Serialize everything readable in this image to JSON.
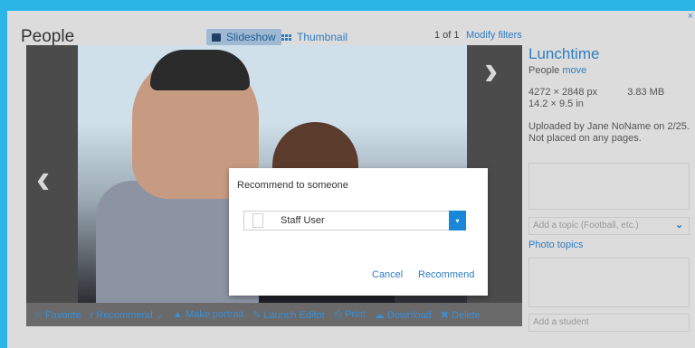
{
  "header": {
    "title": "People",
    "slideshow_label": "Slideshow",
    "thumbnail_label": "Thumbnail",
    "counter": "1 of 1",
    "modify_filters": "Modify filters",
    "close": "×"
  },
  "viewer": {
    "prev": "‹",
    "next": "›"
  },
  "toolbar": {
    "favorite": "☆ Favorite",
    "recommend": "r Recommend ⌄",
    "make_portrait": "▲ Make portrait",
    "launch_editor": "✎ Launch Editor",
    "print": "⎙ Print",
    "download": "☁ Download",
    "delete": "✖ Delete"
  },
  "details": {
    "title": "Lunchtime",
    "section": "People",
    "move": "move",
    "dimensions": "4272 × 2848 px",
    "filesize": "3.83 MB",
    "print_size": "14.2 × 9.5 in",
    "uploaded": "Uploaded by Jane NoName on 2/25.",
    "placement": "Not placed on any pages.",
    "topic_placeholder": "Add a topic (Football, etc.)",
    "photo_topics": "Photo topics",
    "student_placeholder": "Add a student"
  },
  "modal": {
    "title": "Recommend to someone",
    "selected_user": "Staff User",
    "cancel": "Cancel",
    "recommend": "Recommend"
  },
  "colors": {
    "frame": "#29b6e6",
    "accent": "#2f7ec0",
    "select_button": "#1a86d8"
  }
}
